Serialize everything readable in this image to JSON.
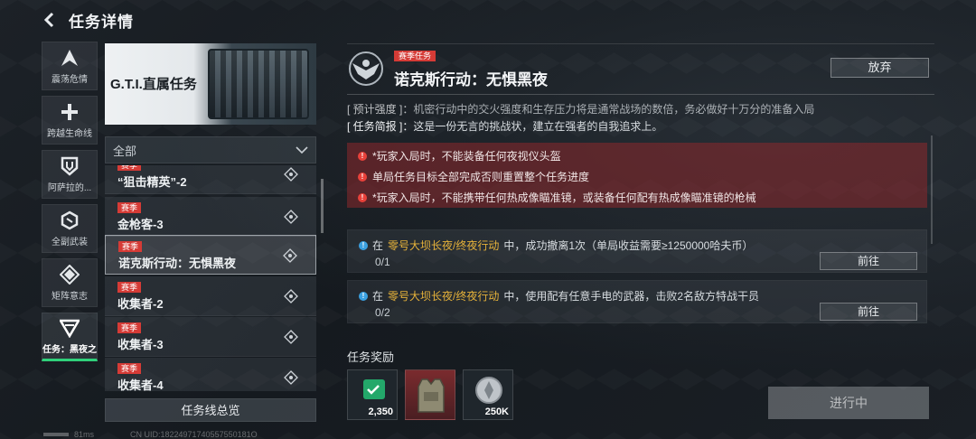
{
  "header": {
    "title": "任务详情"
  },
  "rail": {
    "items": [
      {
        "label": "震荡危情",
        "icon": "a-chevron-icon"
      },
      {
        "label": "跨越生命线",
        "icon": "plus-icon"
      },
      {
        "label": "阿萨拉的...",
        "icon": "shield-icon"
      },
      {
        "label": "全副武装",
        "icon": "hex-icon"
      },
      {
        "label": "矩阵意志",
        "icon": "matrix-icon"
      },
      {
        "label": "任务：黑夜之",
        "icon": "v-emblem-icon"
      }
    ]
  },
  "banner": {
    "title": "G.T.I.直属任务"
  },
  "filter": {
    "selected": "全部"
  },
  "missions": [
    {
      "tag": "赛季",
      "name": "“狙击精英”-2"
    },
    {
      "tag": "赛季",
      "name": "金枪客-3"
    },
    {
      "tag": "赛季",
      "name": "诺克斯行动：无惧黑夜"
    },
    {
      "tag": "赛季",
      "name": "收集者-2"
    },
    {
      "tag": "赛季",
      "name": "收集者-3"
    },
    {
      "tag": "赛季",
      "name": "收集者-4"
    }
  ],
  "summary_button": "任务线总览",
  "detail": {
    "tag": "赛季任务",
    "title": "诺克斯行动：无惧黑夜",
    "abandon": "放弃",
    "intensity_key": "[ 预计强度 ]：",
    "intensity_text": "机密行动中的交火强度和生存压力将是通常战场的数倍，务必做好十万分的准备入局",
    "brief_key": "[ 任务简报 ]：",
    "brief_text": "这是一份无言的挑战状，建立在强者的自我追求上。",
    "warnings": [
      "*玩家入局时，不能装备任何夜视仪头盔",
      "单局任务目标全部完成否则重置整个任务进度",
      "*玩家入局时，不能携带任何热成像瞄准镜，或装备任何配有热成像瞄准镜的枪械"
    ],
    "tasks": [
      {
        "prefix": "在",
        "map": "零号大坝长夜/终夜行动",
        "suffix": "中，成功撤离1次（单局收益需要≥1250000哈夫币）",
        "progress": "0/1",
        "button": "前往"
      },
      {
        "prefix": "在",
        "map": "零号大坝长夜/终夜行动",
        "suffix": "中，使用配有任意手电的武器，击败2名敌方特战干员",
        "progress": "0/2",
        "button": "前往"
      }
    ],
    "rewards_label": "任务奖励",
    "rewards": [
      {
        "qty": "2,350",
        "icon": "green-token-icon"
      },
      {
        "qty": "",
        "icon": "armor-vest-icon"
      },
      {
        "qty": "250K",
        "icon": "silver-coin-icon"
      }
    ],
    "status_button": "进行中"
  },
  "footer": {
    "ping": "81ms",
    "uid": "CN UID:18224971740557550181O"
  },
  "colors": {
    "accent_green": "#2fd07a",
    "season_red": "#d53b36",
    "highlight": "#e6b23a",
    "warn_bg": "#8c282c"
  }
}
